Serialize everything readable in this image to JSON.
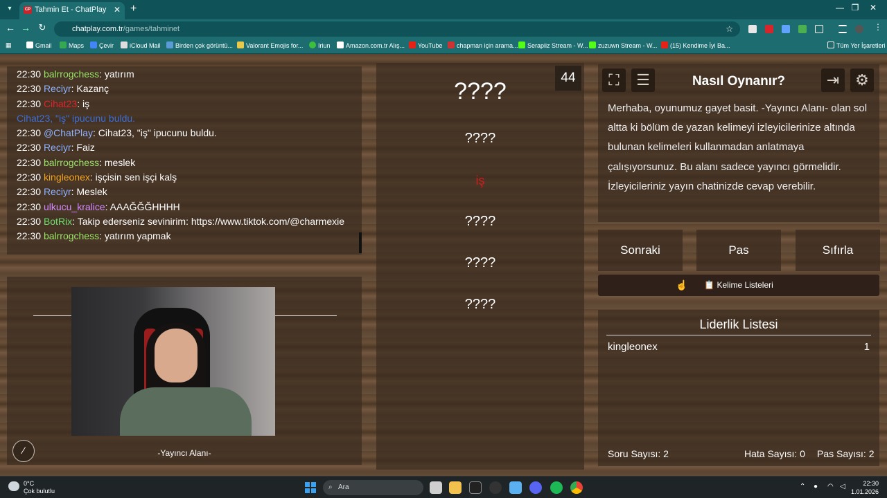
{
  "browser": {
    "tab_title": "Tahmin Et - ChatPlay",
    "tab_favicon": "CP",
    "url_host": "chatplay.com.tr",
    "url_path": "/games/tahminet",
    "bookmarks": [
      "Gmail",
      "Maps",
      "Çevir",
      "iCloud Mail",
      "Birden çok görüntü...",
      "Valorant Emojis for...",
      "Iriun",
      "Amazon.com.tr Alış...",
      "YouTube",
      "chapman için arama...",
      "Serapiiz Stream - W...",
      "zuzuwn Stream - W...",
      "(15) Kendime İyi Ba..."
    ],
    "all_bookmarks": "Tüm Yer İşaretleri"
  },
  "chat": {
    "messages": [
      {
        "time": "22:30",
        "user": "balrrogchess",
        "color": "#9be36a",
        "sep": ": ",
        "text": "yatırım"
      },
      {
        "time": "22:30",
        "user": "Reciyr",
        "color": "#8fb3ff",
        "sep": ": ",
        "text": "Kazanç"
      },
      {
        "time": "22:30",
        "user": "Cihat23",
        "color": "#e0242a",
        "sep": ": ",
        "text": "iş"
      },
      {
        "time": "",
        "user": "Cihat23, \"iş\" ipucunu buldu.",
        "color": "#3d6fd6",
        "sep": "",
        "text": ""
      },
      {
        "time": "22:30",
        "user": "@ChatPlay",
        "color": "#8fb3ff",
        "sep": ": ",
        "text": "Cihat23, \"iş\" ipucunu buldu."
      },
      {
        "time": "22:30",
        "user": "Reciyr",
        "color": "#8fb3ff",
        "sep": ": ",
        "text": "Faiz"
      },
      {
        "time": "22:30",
        "user": "balrrogchess",
        "color": "#9be36a",
        "sep": ": ",
        "text": "meslek"
      },
      {
        "time": "22:30",
        "user": "kingleonex",
        "color": "#f5a623",
        "sep": ": ",
        "text": "işçisin sen işçi kalş"
      },
      {
        "time": "22:30",
        "user": "Reciyr",
        "color": "#8fb3ff",
        "sep": ": ",
        "text": "Meslek"
      },
      {
        "time": "22:30",
        "user": "ulkucu_kralice",
        "color": "#d48bff",
        "sep": ": ",
        "text": "AAAĞĞĞHHHH"
      },
      {
        "time": "22:30",
        "user": "BotRix",
        "color": "#6ee06e",
        "sep": ": ",
        "text": "Takip ederseniz sevinirim: https://www.tiktok.com/@charmexie"
      },
      {
        "time": "22:30",
        "user": "balrrogchess",
        "color": "#9be36a",
        "sep": ": ",
        "text": "yatırım yapmak"
      }
    ]
  },
  "streamer": {
    "label": "-Yayıncı Alanı-"
  },
  "words": {
    "counter": "44",
    "items": [
      "????",
      "????",
      "iş",
      "????",
      "????",
      "????"
    ]
  },
  "howto": {
    "title": "Nasıl Oynanır?",
    "text": "Merhaba, oyunumuz gayet basit. -Yayıncı Alanı- olan sol altta ki bölüm de yazan kelimeyi izleyicilerinize altında bulunan kelimeleri kullanmadan anlatmaya çalışıyorsunuz. Bu alanı sadece yayıncı görmelidir. İzleyicileriniz yayın chatinizde cevap verebilir."
  },
  "actions": {
    "next": "Sonraki",
    "pass": "Pas",
    "reset": "Sıfırla",
    "word_lists": "📋 Kelime Listeleri"
  },
  "leaderboard": {
    "title": "Liderlik Listesi",
    "rows": [
      {
        "name": "kingleonex",
        "score": "1"
      }
    ],
    "question_count": "Soru Sayısı: 2",
    "error_count": "Hata Sayısı: 0",
    "pass_count": "Pas Sayısı: 2"
  },
  "taskbar": {
    "temp": "0°C",
    "weather": "Çok bulutlu",
    "search_placeholder": "Ara",
    "time": "22:30",
    "date": "1.01.2026"
  }
}
